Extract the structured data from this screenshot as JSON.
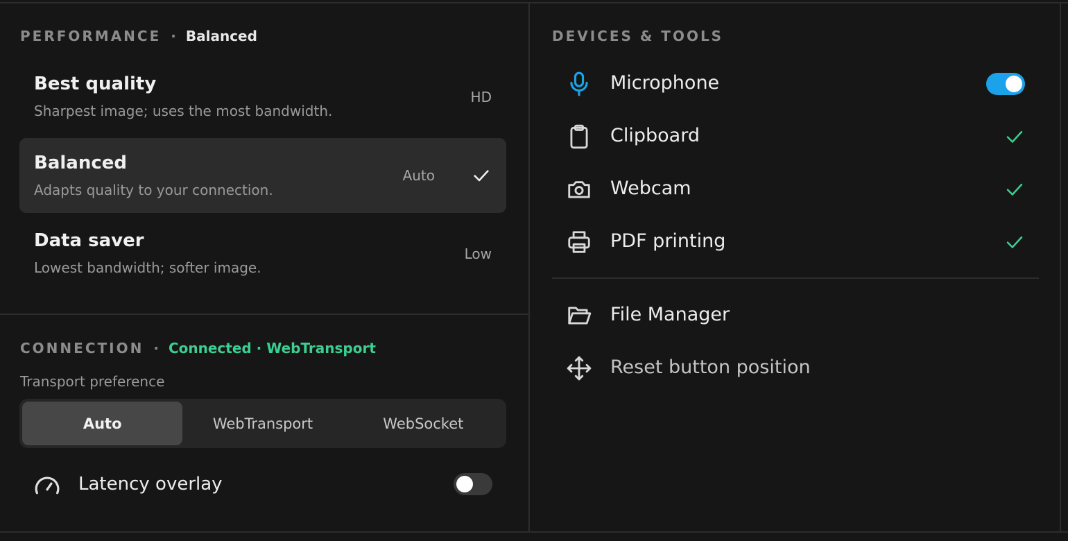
{
  "performance": {
    "title": "PERFORMANCE",
    "separator": "·",
    "current": "Balanced",
    "options": [
      {
        "name": "Best quality",
        "desc": "Sharpest image; uses the most bandwidth.",
        "badge": "HD",
        "selected": false
      },
      {
        "name": "Balanced",
        "desc": "Adapts quality to your connection.",
        "badge": "Auto",
        "selected": true
      },
      {
        "name": "Data saver",
        "desc": "Lowest bandwidth; softer image.",
        "badge": "Low",
        "selected": false
      }
    ]
  },
  "connection": {
    "title": "CONNECTION",
    "separator": "·",
    "status": "Connected · WebTransport",
    "status_color": "#3ccf91",
    "transport_label": "Transport preference",
    "transport_options": [
      "Auto",
      "WebTransport",
      "WebSocket"
    ],
    "transport_selected": "Auto",
    "latency_overlay": {
      "label": "Latency overlay",
      "icon": "gauge-icon",
      "enabled": false
    }
  },
  "devices": {
    "title": "DEVICES & TOOLS",
    "items": [
      {
        "label": "Microphone",
        "icon": "microphone-icon",
        "control": "toggle",
        "enabled": true
      },
      {
        "label": "Clipboard",
        "icon": "clipboard-icon",
        "control": "check",
        "enabled": true
      },
      {
        "label": "Webcam",
        "icon": "camera-icon",
        "control": "check",
        "enabled": true
      },
      {
        "label": "PDF printing",
        "icon": "printer-icon",
        "control": "check",
        "enabled": true
      }
    ],
    "tools": [
      {
        "label": "File Manager",
        "icon": "folder-open-icon"
      },
      {
        "label": "Reset button position",
        "icon": "move-icon"
      }
    ]
  },
  "colors": {
    "accent": "#1ba2e8",
    "success": "#3ccf91",
    "background": "#161616",
    "selected_row": "#2c2c2c"
  }
}
